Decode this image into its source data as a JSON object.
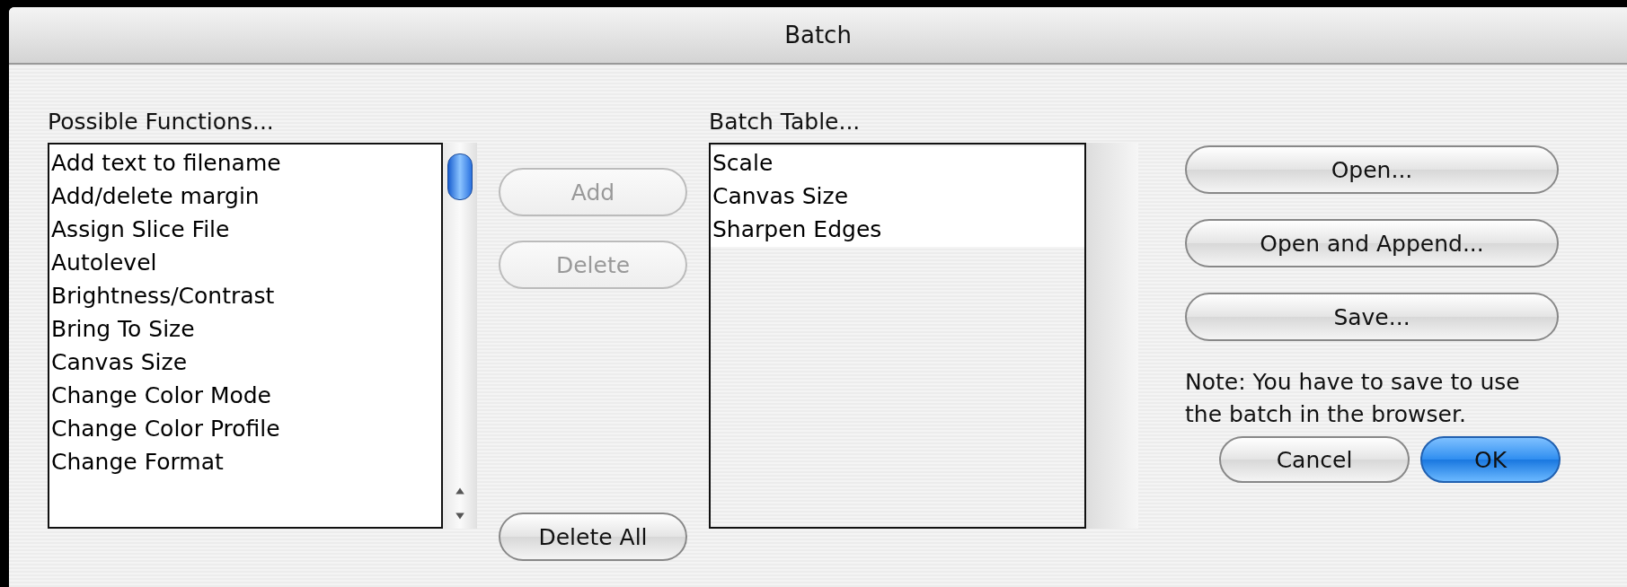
{
  "window": {
    "title": "Batch"
  },
  "possible_functions": {
    "label": "Possible Functions...",
    "items": [
      {
        "label": "Add text to filename"
      },
      {
        "label": "Add/delete margin"
      },
      {
        "label": "Assign Slice File"
      },
      {
        "label": "Autolevel"
      },
      {
        "label": "Brightness/Contrast"
      },
      {
        "label": "Bring To Size"
      },
      {
        "label": "Canvas Size"
      },
      {
        "label": "Change Color Mode"
      },
      {
        "label": "Change Color Profile"
      },
      {
        "label": "Change Format"
      }
    ]
  },
  "middle_buttons": [
    {
      "label": "Add",
      "disabled": true,
      "kind": "top"
    },
    {
      "label": "Delete",
      "disabled": true,
      "kind": "top"
    },
    {
      "label": "Delete All",
      "disabled": false,
      "kind": "bottom"
    }
  ],
  "batch_table": {
    "label": "Batch Table...",
    "items": [
      {
        "label": "Scale"
      },
      {
        "label": "Canvas Size"
      },
      {
        "label": "Sharpen Edges"
      }
    ]
  },
  "file_buttons": [
    {
      "label": "Open..."
    },
    {
      "label": "Open and Append..."
    },
    {
      "label": "Save..."
    }
  ],
  "note": "Note: You have to save to use the batch in the browser.",
  "dialog_buttons": [
    {
      "label": "Cancel",
      "default": false
    },
    {
      "label": "OK",
      "default": true
    }
  ]
}
